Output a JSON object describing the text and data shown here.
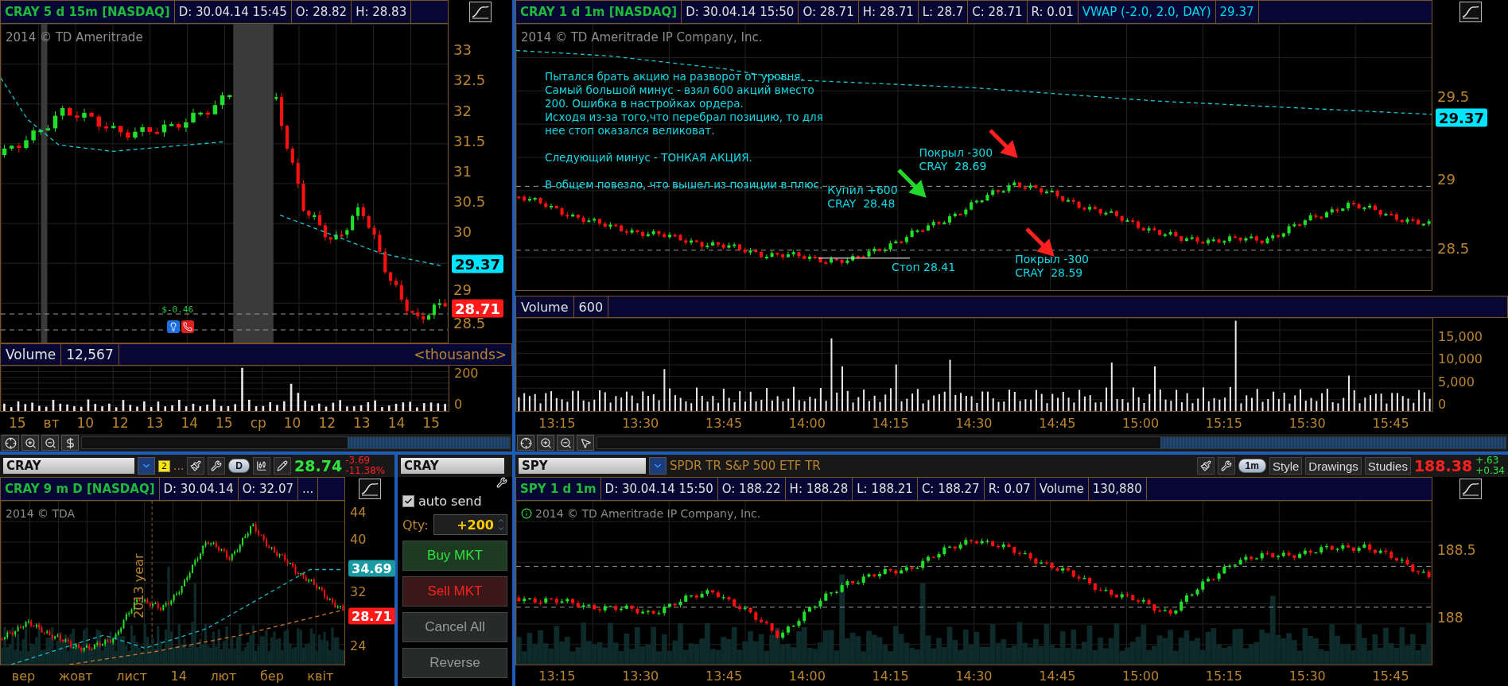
{
  "charts": [
    {
      "header": [
        {
          "text": "CRAY 5 d 15m [NASDAQ]",
          "kind": "title"
        },
        {
          "text": "D: 30.04.14 15:45",
          "kind": "field"
        },
        {
          "text": "O: 28.82",
          "kind": "field"
        },
        {
          "text": "H: 28.83",
          "kind": "field"
        }
      ],
      "watermark": "2014 © TD Ameritrade",
      "price_ticks": [
        "33",
        "32.5",
        "32",
        "31.5",
        "31",
        "30.5",
        "30",
        "29",
        "28.5"
      ],
      "price_badges": [
        {
          "text": "29.37",
          "color": "#00e5ff"
        },
        {
          "text": "28.71",
          "color": "#ff1a1a"
        }
      ],
      "trade_marker": "$-0.46",
      "volume": {
        "label": "Volume",
        "value": "12,567",
        "unit": "<thousands>",
        "ticks": [
          "200",
          "0"
        ]
      },
      "time_ticks": [
        "15",
        "вт",
        "10",
        "12",
        "13",
        "14",
        "15",
        "ср",
        "10",
        "12",
        "13",
        "14",
        "15"
      ]
    },
    {
      "header": [
        {
          "text": "CRAY 1 d 1m [NASDAQ]",
          "kind": "title"
        },
        {
          "text": "D: 30.04.14 15:50",
          "kind": "field"
        },
        {
          "text": "O: 28.71",
          "kind": "field"
        },
        {
          "text": "H: 28.71",
          "kind": "field"
        },
        {
          "text": "L: 28.7",
          "kind": "field"
        },
        {
          "text": "C: 28.71",
          "kind": "field"
        },
        {
          "text": "R: 0.01",
          "kind": "field"
        },
        {
          "text": "VWAP (-2.0, 2.0, DAY)",
          "kind": "study"
        },
        {
          "text": "29.37",
          "kind": "study"
        }
      ],
      "watermark": "2014 © TD Ameritrade IP Company, Inc.",
      "price_ticks": [
        "29.5",
        "29",
        "28.5"
      ],
      "price_badges": [
        {
          "text": "29.37",
          "color": "#00e5ff"
        }
      ],
      "note": [
        [
          "Пытался брать акцию на разворот от уровня.",
          "Самый большой минус - взял 600 акций вместо",
          "200. Ошибка в настройках ордера.",
          "Исходя из-за того,что перебрал позицию, то для",
          "нее стоп оказался великоват."
        ],
        [
          "Следующий минус - ТОНКАЯ АКЦИЯ."
        ],
        [
          "В общем повезло, что вышел из позиции в плюс."
        ]
      ],
      "trade_labels": [
        {
          "lines": [
            "Купил +600",
            "CRAY  28.48"
          ],
          "kind": "buy"
        },
        {
          "lines": [
            "Стоп 28.41"
          ],
          "kind": "stop"
        },
        {
          "lines": [
            "Покрыл -300",
            "CRAY  28.69"
          ],
          "kind": "sell"
        },
        {
          "lines": [
            "Покрыл -300",
            "CRAY  28.59"
          ],
          "kind": "sell"
        }
      ],
      "volume": {
        "label": "Volume",
        "value": "600",
        "ticks": [
          "15,000",
          "10,000",
          "5,000",
          "0"
        ]
      },
      "time_ticks": [
        "13:15",
        "13:30",
        "13:45",
        "14:00",
        "14:15",
        "14:30",
        "14:45",
        "15:00",
        "15:15",
        "15:30",
        "15:45"
      ]
    }
  ],
  "daily": {
    "symbol": "CRAY",
    "link_badge": "2",
    "more": "...",
    "period": "D",
    "last": "28.74",
    "change": "-3.69",
    "change_pct": "-11.38%",
    "header": [
      {
        "text": "CRAY 9 m D [NASDAQ]",
        "kind": "title"
      },
      {
        "text": "D: 30.04.14",
        "kind": "field"
      },
      {
        "text": "O: 32.07",
        "kind": "field"
      },
      {
        "text": "...",
        "kind": "field"
      }
    ],
    "watermark": "2014 © TDA",
    "year_label": "2013 year",
    "price_ticks": [
      "44",
      "40",
      "32",
      "24"
    ],
    "price_badges": [
      {
        "text": "34.69",
        "color": "#1a9ba3"
      },
      {
        "text": "28.71",
        "color": "#ff1a1a"
      }
    ],
    "time_ticks": [
      "вер",
      "жовт",
      "лист",
      "14",
      "лют",
      "бер",
      "квіт"
    ]
  },
  "order": {
    "symbol": "CRAY",
    "auto_send": {
      "label": "auto send",
      "checked": true
    },
    "qty_label": "Qty:",
    "qty": "+200",
    "buttons": [
      {
        "label": "Buy MKT",
        "kind": "buy"
      },
      {
        "label": "Sell MKT",
        "kind": "sell"
      },
      {
        "label": "Cancel All",
        "kind": "neutral"
      },
      {
        "label": "Reverse",
        "kind": "neutral"
      }
    ]
  },
  "spy": {
    "symbol": "SPY",
    "description": "SPDR TR S&P 500 ETF TR",
    "period": "1m",
    "menu": [
      "Style",
      "Drawings",
      "Studies"
    ],
    "last": "188.38",
    "change": "+.63",
    "change_pct": "+0.34",
    "header": [
      {
        "text": "SPY 1 d 1m",
        "kind": "title"
      },
      {
        "text": "D: 30.04.14 15:50",
        "kind": "field"
      },
      {
        "text": "O: 188.22",
        "kind": "field"
      },
      {
        "text": "H: 188.28",
        "kind": "field"
      },
      {
        "text": "L: 188.21",
        "kind": "field"
      },
      {
        "text": "C: 188.27",
        "kind": "field"
      },
      {
        "text": "R: 0.07",
        "kind": "field"
      },
      {
        "text": "Volume",
        "kind": "field"
      },
      {
        "text": "130,880",
        "kind": "field"
      }
    ],
    "watermark": "2014 © TD Ameritrade IP Company, Inc.",
    "price_ticks": [
      "188.5",
      "188"
    ],
    "time_ticks": [
      "13:15",
      "13:30",
      "13:45",
      "14:00",
      "14:15",
      "14:30",
      "14:45",
      "15:00",
      "15:15",
      "15:30",
      "15:45"
    ]
  }
}
